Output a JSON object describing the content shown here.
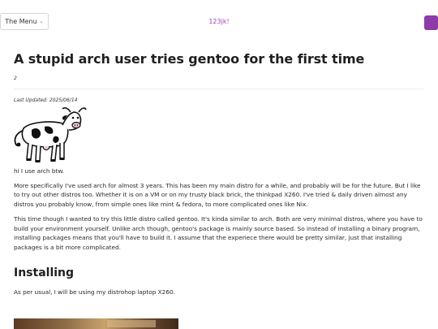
{
  "nav": {
    "menu_label": "The Menu",
    "brand": "123jk!"
  },
  "article": {
    "title": "A stupid arch user tries gentoo for the first time",
    "meta_number": "2",
    "last_updated": "Last Updated: 2025/06/14",
    "image_name": "cow-illustration",
    "paragraphs": [
      "hi I use arch btw.",
      "More specifically I've used arch for almost 3 years. This has been my main distro for a while, and probably will be for the future. But I like to try out other distros too. Whether it is on a VM or on my trusty black brick, the thinkpad X260. I've tried & daily driven almost any distros you probably know, from simple ones like mint & fedora, to more complicated ones like Nix.",
      "This time though I wanted to try this little distro called gentoo. It's kinda similar to arch. Both are very minimal distros, where you have to build your environment yourself. Unlike arch though, gentoo's package is mainly source based. So instead of installing a binary program, installing packages means that you'll have to build it. I assume that the experiece there would be pretty similar, just that installing packages is a bit more complicated."
    ],
    "section": {
      "heading": "Installing",
      "paragraph": "As per usual, I will be using my distrohop laptop X260."
    }
  },
  "colors": {
    "brand": "#a340b5",
    "corner_button": "#8e3aa8"
  }
}
